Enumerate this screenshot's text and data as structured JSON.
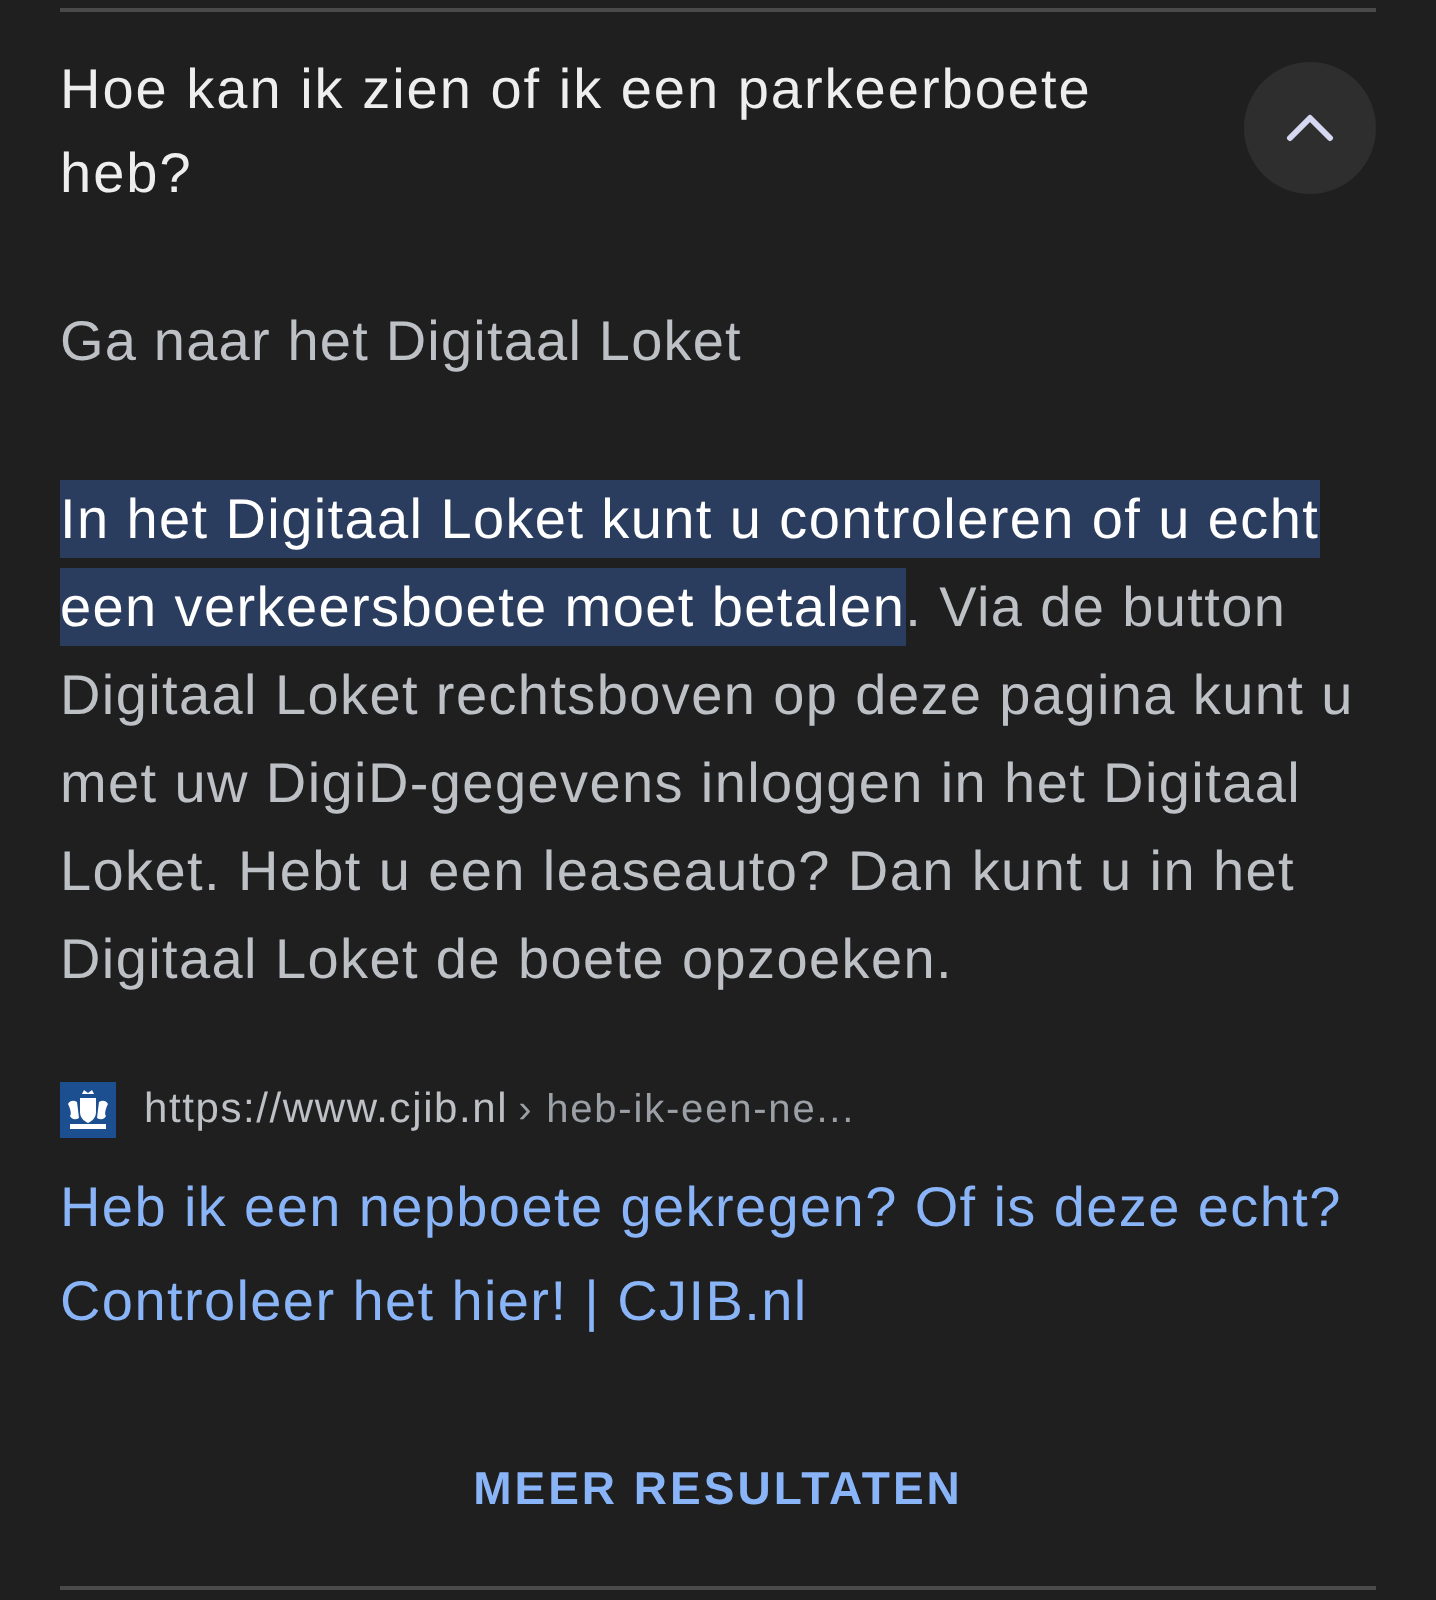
{
  "question": {
    "title": "Hoe kan ik zien of ik een parkeerboete heb?",
    "expanded": true
  },
  "answer": {
    "heading": "Ga naar het Digitaal Loket",
    "paragraph": [
      {
        "text": "In het Digitaal Loket kunt u controleren of u echt een verkeersboete moet betalen",
        "highlighted": true
      },
      {
        "text": ". Via de button Digitaal Loket rechtsboven op deze pagina kunt u met uw DigiD-gegevens inloggen in het Digitaal Loket. Hebt u een leaseauto? Dan kunt u in het Digitaal Loket de boete opzoeken.",
        "highlighted": false
      }
    ]
  },
  "source": {
    "url": "https://www.cjib.nl",
    "path": "› heb-ik-een-ne...",
    "title": "Heb ik een nepboete gekregen? Of is deze echt? Controleer het hier! | CJIB.nl"
  },
  "more_button": {
    "label": "MEER RESULTATEN"
  }
}
